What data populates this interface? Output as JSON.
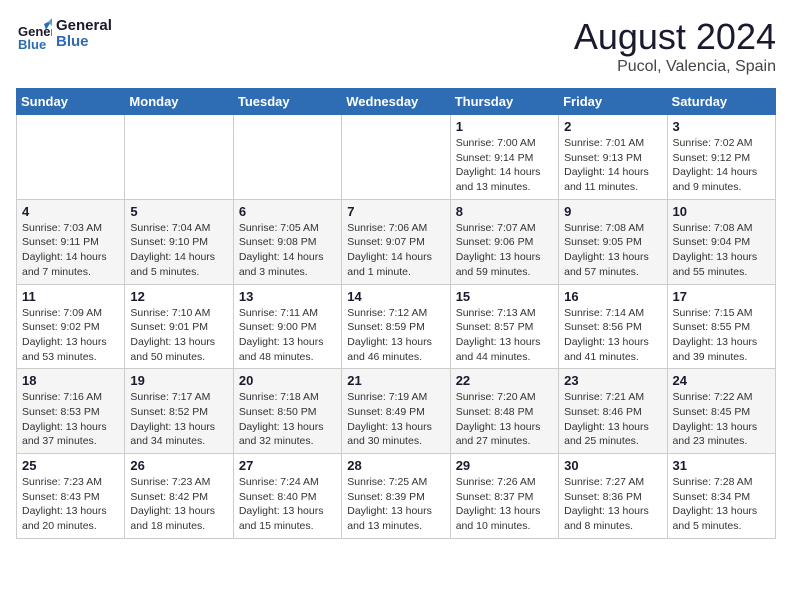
{
  "header": {
    "logo_line1": "General",
    "logo_line2": "Blue",
    "main_title": "August 2024",
    "subtitle": "Pucol, Valencia, Spain"
  },
  "weekdays": [
    "Sunday",
    "Monday",
    "Tuesday",
    "Wednesday",
    "Thursday",
    "Friday",
    "Saturday"
  ],
  "weeks": [
    [
      {
        "day": "",
        "info": ""
      },
      {
        "day": "",
        "info": ""
      },
      {
        "day": "",
        "info": ""
      },
      {
        "day": "",
        "info": ""
      },
      {
        "day": "1",
        "info": "Sunrise: 7:00 AM\nSunset: 9:14 PM\nDaylight: 14 hours\nand 13 minutes."
      },
      {
        "day": "2",
        "info": "Sunrise: 7:01 AM\nSunset: 9:13 PM\nDaylight: 14 hours\nand 11 minutes."
      },
      {
        "day": "3",
        "info": "Sunrise: 7:02 AM\nSunset: 9:12 PM\nDaylight: 14 hours\nand 9 minutes."
      }
    ],
    [
      {
        "day": "4",
        "info": "Sunrise: 7:03 AM\nSunset: 9:11 PM\nDaylight: 14 hours\nand 7 minutes."
      },
      {
        "day": "5",
        "info": "Sunrise: 7:04 AM\nSunset: 9:10 PM\nDaylight: 14 hours\nand 5 minutes."
      },
      {
        "day": "6",
        "info": "Sunrise: 7:05 AM\nSunset: 9:08 PM\nDaylight: 14 hours\nand 3 minutes."
      },
      {
        "day": "7",
        "info": "Sunrise: 7:06 AM\nSunset: 9:07 PM\nDaylight: 14 hours\nand 1 minute."
      },
      {
        "day": "8",
        "info": "Sunrise: 7:07 AM\nSunset: 9:06 PM\nDaylight: 13 hours\nand 59 minutes."
      },
      {
        "day": "9",
        "info": "Sunrise: 7:08 AM\nSunset: 9:05 PM\nDaylight: 13 hours\nand 57 minutes."
      },
      {
        "day": "10",
        "info": "Sunrise: 7:08 AM\nSunset: 9:04 PM\nDaylight: 13 hours\nand 55 minutes."
      }
    ],
    [
      {
        "day": "11",
        "info": "Sunrise: 7:09 AM\nSunset: 9:02 PM\nDaylight: 13 hours\nand 53 minutes."
      },
      {
        "day": "12",
        "info": "Sunrise: 7:10 AM\nSunset: 9:01 PM\nDaylight: 13 hours\nand 50 minutes."
      },
      {
        "day": "13",
        "info": "Sunrise: 7:11 AM\nSunset: 9:00 PM\nDaylight: 13 hours\nand 48 minutes."
      },
      {
        "day": "14",
        "info": "Sunrise: 7:12 AM\nSunset: 8:59 PM\nDaylight: 13 hours\nand 46 minutes."
      },
      {
        "day": "15",
        "info": "Sunrise: 7:13 AM\nSunset: 8:57 PM\nDaylight: 13 hours\nand 44 minutes."
      },
      {
        "day": "16",
        "info": "Sunrise: 7:14 AM\nSunset: 8:56 PM\nDaylight: 13 hours\nand 41 minutes."
      },
      {
        "day": "17",
        "info": "Sunrise: 7:15 AM\nSunset: 8:55 PM\nDaylight: 13 hours\nand 39 minutes."
      }
    ],
    [
      {
        "day": "18",
        "info": "Sunrise: 7:16 AM\nSunset: 8:53 PM\nDaylight: 13 hours\nand 37 minutes."
      },
      {
        "day": "19",
        "info": "Sunrise: 7:17 AM\nSunset: 8:52 PM\nDaylight: 13 hours\nand 34 minutes."
      },
      {
        "day": "20",
        "info": "Sunrise: 7:18 AM\nSunset: 8:50 PM\nDaylight: 13 hours\nand 32 minutes."
      },
      {
        "day": "21",
        "info": "Sunrise: 7:19 AM\nSunset: 8:49 PM\nDaylight: 13 hours\nand 30 minutes."
      },
      {
        "day": "22",
        "info": "Sunrise: 7:20 AM\nSunset: 8:48 PM\nDaylight: 13 hours\nand 27 minutes."
      },
      {
        "day": "23",
        "info": "Sunrise: 7:21 AM\nSunset: 8:46 PM\nDaylight: 13 hours\nand 25 minutes."
      },
      {
        "day": "24",
        "info": "Sunrise: 7:22 AM\nSunset: 8:45 PM\nDaylight: 13 hours\nand 23 minutes."
      }
    ],
    [
      {
        "day": "25",
        "info": "Sunrise: 7:23 AM\nSunset: 8:43 PM\nDaylight: 13 hours\nand 20 minutes."
      },
      {
        "day": "26",
        "info": "Sunrise: 7:23 AM\nSunset: 8:42 PM\nDaylight: 13 hours\nand 18 minutes."
      },
      {
        "day": "27",
        "info": "Sunrise: 7:24 AM\nSunset: 8:40 PM\nDaylight: 13 hours\nand 15 minutes."
      },
      {
        "day": "28",
        "info": "Sunrise: 7:25 AM\nSunset: 8:39 PM\nDaylight: 13 hours\nand 13 minutes."
      },
      {
        "day": "29",
        "info": "Sunrise: 7:26 AM\nSunset: 8:37 PM\nDaylight: 13 hours\nand 10 minutes."
      },
      {
        "day": "30",
        "info": "Sunrise: 7:27 AM\nSunset: 8:36 PM\nDaylight: 13 hours\nand 8 minutes."
      },
      {
        "day": "31",
        "info": "Sunrise: 7:28 AM\nSunset: 8:34 PM\nDaylight: 13 hours\nand 5 minutes."
      }
    ]
  ]
}
